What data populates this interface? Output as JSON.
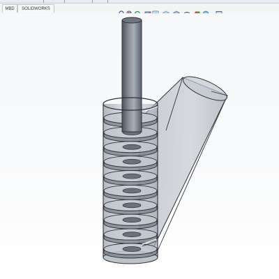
{
  "tabs": [
    {
      "label": "MBD"
    },
    {
      "label": "SOLIDWORKS CAM"
    }
  ],
  "view_toolbar": {
    "icons": [
      "zoom-to-fit-icon",
      "zoom-to-area-icon",
      "previous-view-icon",
      "section-view-icon",
      "dynamic-annotation-view-icon",
      "view-orientation-icon",
      "display-style-icon",
      "hide-show-items-icon",
      "edit-appearance-icon",
      "apply-scene-icon",
      "view-settings-icon"
    ]
  },
  "model": {
    "flight_count": 10,
    "colors": {
      "background": "#f6f8fa",
      "steel_light": "#b9bec7",
      "steel_dark": "#5a616c",
      "edge": "#2e333a",
      "glass": "#c9ced6"
    }
  }
}
